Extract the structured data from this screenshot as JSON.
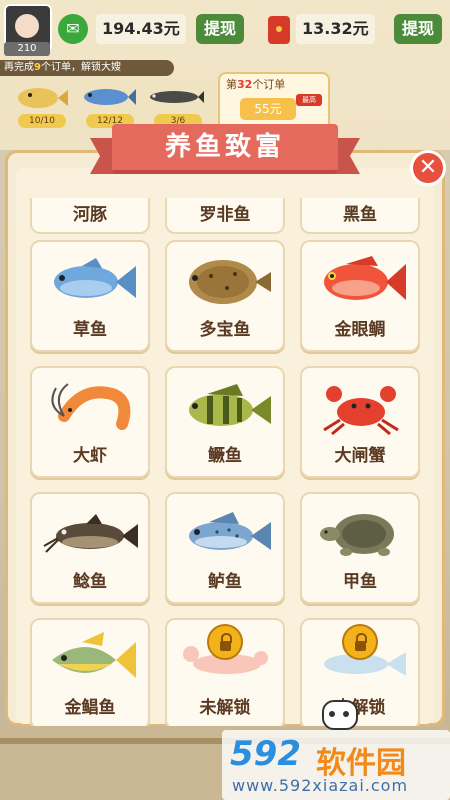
{
  "hud": {
    "level": "210",
    "wechat_balance": "194.43元",
    "redpacket_balance": "13.32元",
    "withdraw_label_1": "提现",
    "withdraw_label_2": "提现",
    "task_prefix": "再完成",
    "task_count": "9",
    "task_suffix": "个订单，解锁大嫂",
    "fish_counts": [
      "10/10",
      "12/12",
      "3/6"
    ],
    "order_prefix": "第",
    "order_no": "32",
    "order_suffix": "个订单",
    "order_price": "55元",
    "order_tag": "最高"
  },
  "modal": {
    "title": "养鱼致富",
    "close_label": "✕"
  },
  "top_row": [
    "河豚",
    "罗非鱼",
    "黑鱼"
  ],
  "cards": [
    {
      "name": "草鱼",
      "icon": "grass-carp-icon",
      "locked": false
    },
    {
      "name": "多宝鱼",
      "icon": "turbot-icon",
      "locked": false
    },
    {
      "name": "金眼鲷",
      "icon": "red-snapper-icon",
      "locked": false
    },
    {
      "name": "大虾",
      "icon": "shrimp-icon",
      "locked": false
    },
    {
      "name": "鳜鱼",
      "icon": "mandarin-fish-icon",
      "locked": false
    },
    {
      "name": "大闸蟹",
      "icon": "crab-icon",
      "locked": false
    },
    {
      "name": "鲶鱼",
      "icon": "catfish-icon",
      "locked": false
    },
    {
      "name": "鲈鱼",
      "icon": "bass-icon",
      "locked": false
    },
    {
      "name": "甲鱼",
      "icon": "turtle-icon",
      "locked": false
    },
    {
      "name": "金鲳鱼",
      "icon": "pompano-icon",
      "locked": false
    },
    {
      "name": "未解锁",
      "icon": "lobster-icon",
      "locked": true
    },
    {
      "name": "未解锁",
      "icon": "fish-icon",
      "locked": true
    }
  ],
  "watermark": {
    "logo": "592",
    "name": "软件园",
    "url": "www.592xiazai.com"
  },
  "colors": {
    "accent": "#e46a5e",
    "card_border": "#e9d6b2",
    "text": "#5a3a22"
  }
}
